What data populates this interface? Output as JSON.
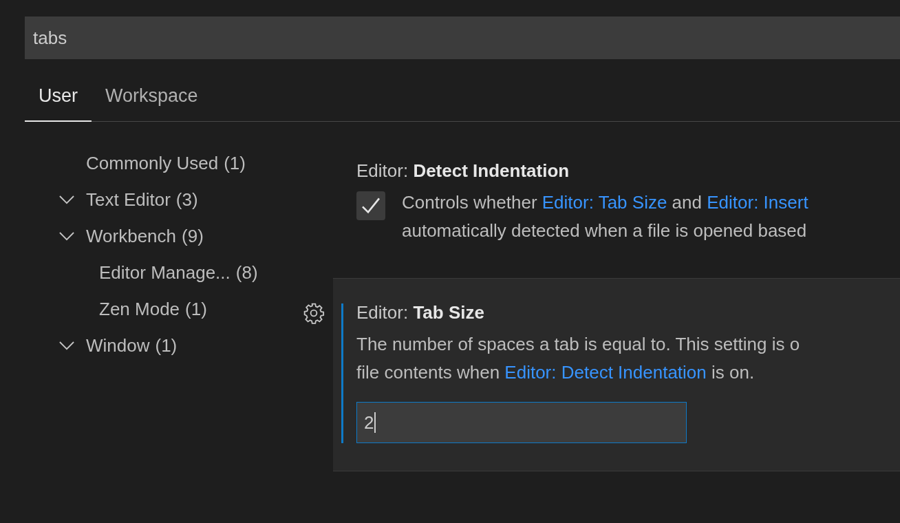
{
  "search": {
    "value": "tabs"
  },
  "tabs": [
    {
      "label": "User",
      "selected": true
    },
    {
      "label": "Workspace",
      "selected": false
    }
  ],
  "tree": [
    {
      "label": "Commonly Used",
      "count": "(1)"
    },
    {
      "label": "Text Editor",
      "count": "(3)",
      "expanded": true
    },
    {
      "label": "Workbench",
      "count": "(9)",
      "expanded": true,
      "children": [
        {
          "label": "Editor Manage...",
          "count": "(8)"
        },
        {
          "label": "Zen Mode",
          "count": "(1)"
        }
      ]
    },
    {
      "label": "Window",
      "count": "(1)",
      "expanded": true
    }
  ],
  "settings": [
    {
      "kind": "checkbox",
      "focused": false,
      "category": "Editor:",
      "name": "Detect Indentation",
      "checked": true,
      "description": [
        [
          {
            "text": "Controls whether ",
            "link": false
          },
          {
            "text": "Editor: Tab Size",
            "link": true
          },
          {
            "text": " and ",
            "link": false
          },
          {
            "text": "Editor: Insert",
            "link": true
          }
        ],
        [
          {
            "text": "automatically detected when a file is opened based",
            "link": false
          }
        ]
      ]
    },
    {
      "kind": "number",
      "focused": true,
      "category": "Editor:",
      "name": "Tab Size",
      "value": "2",
      "description": [
        [
          {
            "text": "The number of spaces a tab is equal to. This setting is o",
            "link": false
          }
        ],
        [
          {
            "text": "file contents when ",
            "link": false
          },
          {
            "text": "Editor: Detect Indentation",
            "link": true
          },
          {
            "text": " is on.",
            "link": false
          }
        ]
      ]
    }
  ]
}
